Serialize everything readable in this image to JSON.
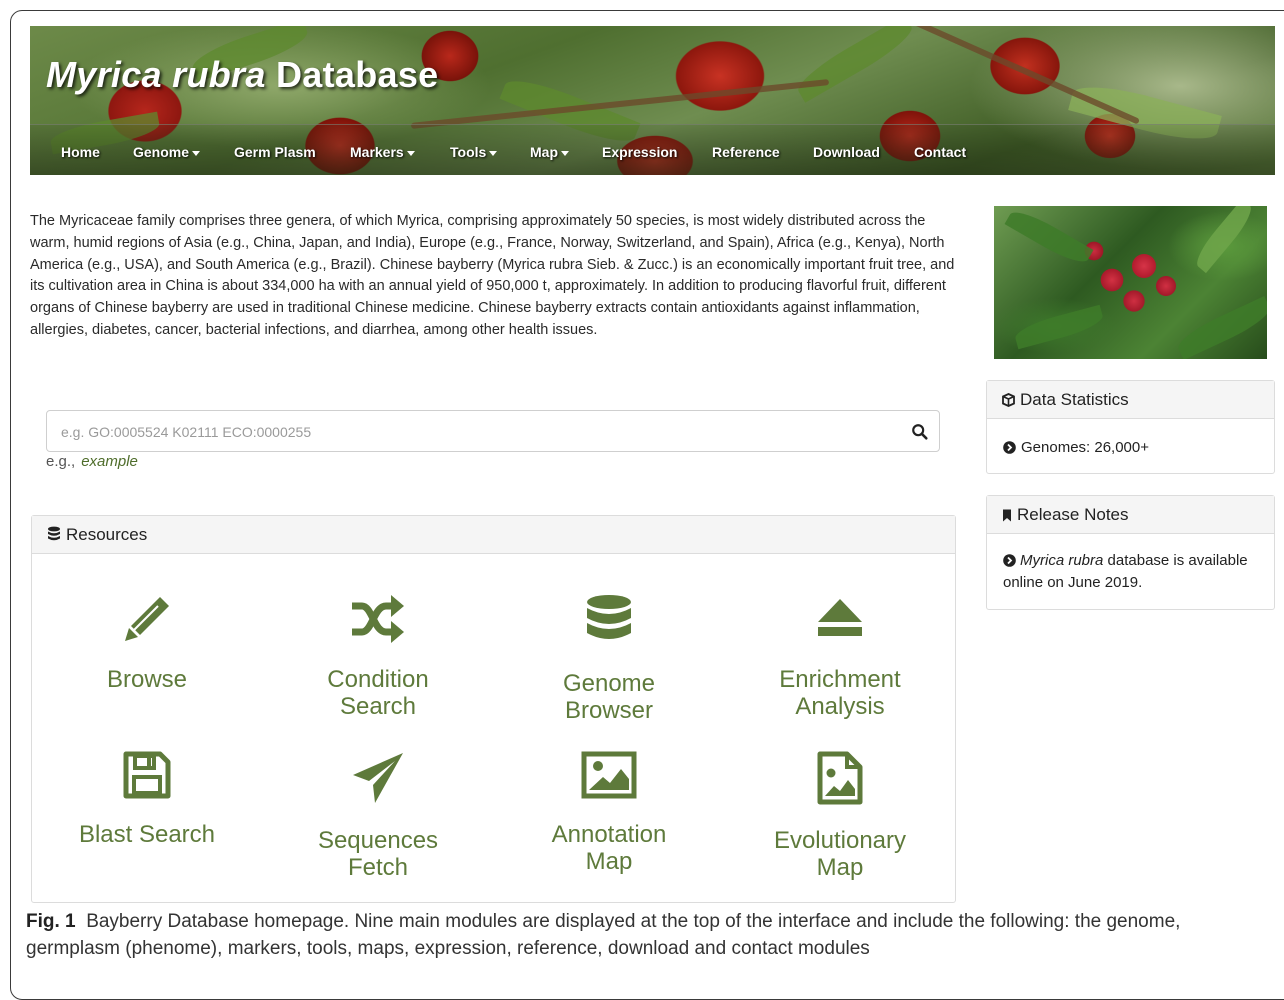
{
  "site": {
    "title_italic": "Myrica rubra",
    "title_rest": " Database"
  },
  "nav": {
    "home": "Home",
    "genome": "Genome",
    "germplasm": "Germ Plasm",
    "markers": "Markers",
    "tools": "Tools",
    "map": "Map",
    "expression": "Expression",
    "reference": "Reference",
    "download": "Download",
    "contact": "Contact"
  },
  "intro": "The Myricaceae family comprises three genera, of which Myrica, comprising approximately 50 species, is most widely distributed across the warm, humid regions of Asia (e.g., China, Japan, and India), Europe (e.g., France, Norway, Switzerland, and Spain), Africa (e.g., Kenya), North America (e.g., USA), and South America (e.g., Brazil). Chinese bayberry (Myrica rubra Sieb. & Zucc.) is an economically important fruit tree, and its cultivation area in China is about 334,000 ha with an annual yield of 950,000 t, approximately. In addition to producing flavorful fruit, different organs of Chinese bayberry are used in traditional Chinese medicine. Chinese bayberry extracts contain antioxidants against inflammation, allergies, diabetes, cancer, bacterial infections, and diarrhea, among other health issues.",
  "search": {
    "placeholder": "e.g. GO:0005524 K02111 ECO:0000255",
    "value": "",
    "eg_label": "e.g.,",
    "eg_link": "example"
  },
  "resources": {
    "heading": "Resources",
    "browse": "Browse",
    "condition_1": "Condition",
    "condition_2": "Search",
    "genome_1": "Genome",
    "genome_2": "Browser",
    "enrich_1": "Enrichment",
    "enrich_2": "Analysis",
    "blast": "Blast Search",
    "seq_1": "Sequences",
    "seq_2": "Fetch",
    "annot_1": "Annotation",
    "annot_2": "Map",
    "evo_1": "Evolutionary",
    "evo_2": "Map"
  },
  "stats": {
    "heading": "Data Statistics",
    "genomes": "Genomes: 26,000+"
  },
  "release": {
    "heading": "Release Notes",
    "species": "Myrica rubra",
    "text": " database is available online on June 2019."
  },
  "caption": {
    "label": "Fig. 1",
    "text": "Bayberry Database homepage. Nine main modules are displayed at the top of the interface and include the following: the genome, germplasm (phenome), markers, tools, maps, expression, reference, download and contact modules"
  },
  "colors": {
    "accent_green": "#5e7a3b",
    "link_green": "#4f6d2b",
    "panel_header_bg": "#f5f5f5"
  }
}
